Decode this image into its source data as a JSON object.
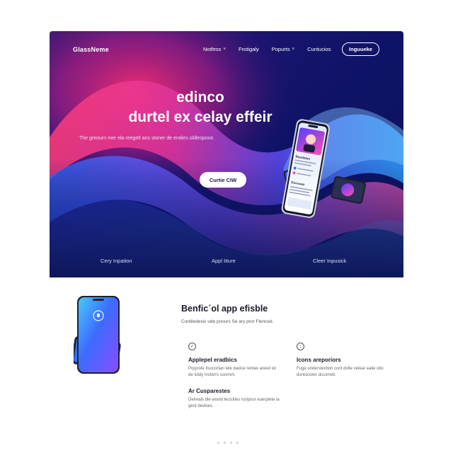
{
  "nav": {
    "brand": "GlassNeme",
    "links": [
      {
        "label": "Notfess",
        "chevron": "˅"
      },
      {
        "label": "Frotigaly",
        "chevron": ""
      },
      {
        "label": "Popurts",
        "chevron": "˅"
      },
      {
        "label": "Cuntucios",
        "chevron": ""
      }
    ],
    "cta": "Inguueke"
  },
  "hero": {
    "title_line1": "edinco",
    "title_line2": "durtel ex celay effeir",
    "subtitle": "The greourn mer ela reegelt ans stoner de endies oldlespoce.",
    "cta": "Curtie CIW",
    "footer_items": [
      "Cery Inpation",
      "Appl Iiture",
      "Cleer Inpusick"
    ]
  },
  "phone": {
    "profile_heading": "Roudsten",
    "list_heading": "Gocuoan"
  },
  "section": {
    "title": "Benfic´ol app efisble",
    "subtitle": "Contiledesis ude pnours Se ary pror Flenced.",
    "features": [
      {
        "icon": "check-circle-icon",
        "glyph": "✓",
        "title": "Applepel eradbics",
        "text": "Prpprole Itsocortan lele davice rentav areed ior de Iutdy Incterrs socrrert."
      },
      {
        "icon": "download-circle-icon",
        "glyph": "↓",
        "title": "Icons areporiors",
        "text": "Fuge understection cont dolte velear ealie oito dontocoles dccorrett."
      },
      {
        "icon": "",
        "glyph": "",
        "title": "Ar Cusparestes",
        "text": "Delreals dle woold lecicities rurlpour euerplete la gent devlees."
      }
    ]
  },
  "pager": {
    "count": 4
  },
  "colors": {
    "hero_bg": "#101566",
    "accent_pink": "#ff2e6e",
    "accent_blue": "#2f6bff",
    "cta_text": "#1b1c3a"
  }
}
